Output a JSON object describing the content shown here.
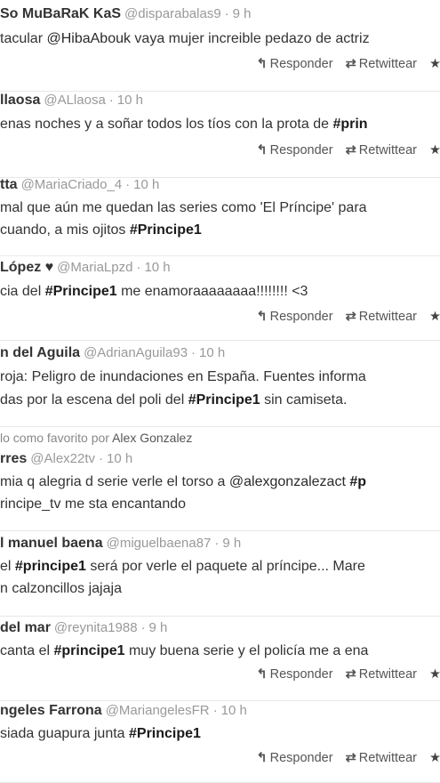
{
  "actions": {
    "reply": "Responder",
    "retweet": "Retwittear",
    "reply_icon": "reply-arrow-icon",
    "retweet_icon": "retweet-icon",
    "favorite_icon": "star-icon"
  },
  "tweets": [
    {
      "name": "So MuBaRaK KaS",
      "handle": "@disparabalas9",
      "time": "9 h",
      "lines": [
        [
          {
            "t": "tacular "
          },
          {
            "t": "@HibaAbouk",
            "k": "mention"
          },
          {
            "t": " vaya mujer increible pedazo de actriz"
          }
        ]
      ]
    },
    {
      "name": "llaosa",
      "handle": "@ALlaosa",
      "time": "10 h",
      "lines": [
        [
          {
            "t": "enas noches y a soñar todos los tíos con la prota de "
          },
          {
            "t": "#prin",
            "k": "hashtag"
          }
        ]
      ]
    },
    {
      "name": "tta",
      "handle": "@MariaCriado_4",
      "time": "10 h",
      "lines": [
        [
          {
            "t": " mal que aún me quedan las series como 'El Príncipe' para"
          }
        ],
        [
          {
            "t": " cuando, a mis ojitos "
          },
          {
            "t": "#Principe1",
            "k": "hashtag"
          }
        ]
      ]
    },
    {
      "name": "López ♥",
      "handle": "@MariaLpzd",
      "time": "10 h",
      "lines": [
        [
          {
            "t": "cia del "
          },
          {
            "t": "#Principe1",
            "k": "hashtag"
          },
          {
            "t": " me enamoraaaaaaaa!!!!!!!! <3"
          }
        ]
      ]
    },
    {
      "name": "n del Aguila",
      "handle": "@AdrianAguila93",
      "time": "10 h",
      "lines": [
        [
          {
            "t": "roja: Peligro de inundaciones en España. Fuentes informa"
          }
        ],
        [
          {
            "t": "das por la escena del poli del "
          },
          {
            "t": "#Principe1",
            "k": "hashtag"
          },
          {
            "t": " sin camiseta."
          }
        ]
      ]
    },
    {
      "fav_prefix": "lo como favorito por",
      "fav_user": "Alex Gonzalez",
      "name": "rres",
      "handle": "@Alex22tv",
      "time": "10 h",
      "lines": [
        [
          {
            "t": " mia q alegria d serie verle el torso a "
          },
          {
            "t": "@alexgonzalezact",
            "k": "mention"
          },
          {
            "t": " "
          },
          {
            "t": "#p",
            "k": "hashtag"
          }
        ],
        [
          {
            "t": "rincipe_tv  me sta encantando"
          }
        ]
      ]
    },
    {
      "name": "l manuel baena",
      "handle": "@miguelbaena87",
      "time": "9 h",
      "lines": [
        [
          {
            "t": "el "
          },
          {
            "t": "#principe1",
            "k": "hashtag"
          },
          {
            "t": " será por verle el paquete al príncipe... Mare"
          }
        ],
        [
          {
            "t": "n calzoncillos jajaja"
          }
        ]
      ]
    },
    {
      "name": "del mar",
      "handle": "@reynita1988",
      "time": "9 h",
      "lines": [
        [
          {
            "t": "canta el "
          },
          {
            "t": "#principe1",
            "k": "hashtag"
          },
          {
            "t": " muy buena serie y el policía me a ena"
          }
        ]
      ]
    },
    {
      "name": "ngeles Farrona",
      "handle": "@MariangelesFR",
      "time": "10 h",
      "lines": [
        [
          {
            "t": "siada guapura junta "
          },
          {
            "t": "#Principe1",
            "k": "hashtag"
          }
        ]
      ]
    }
  ]
}
